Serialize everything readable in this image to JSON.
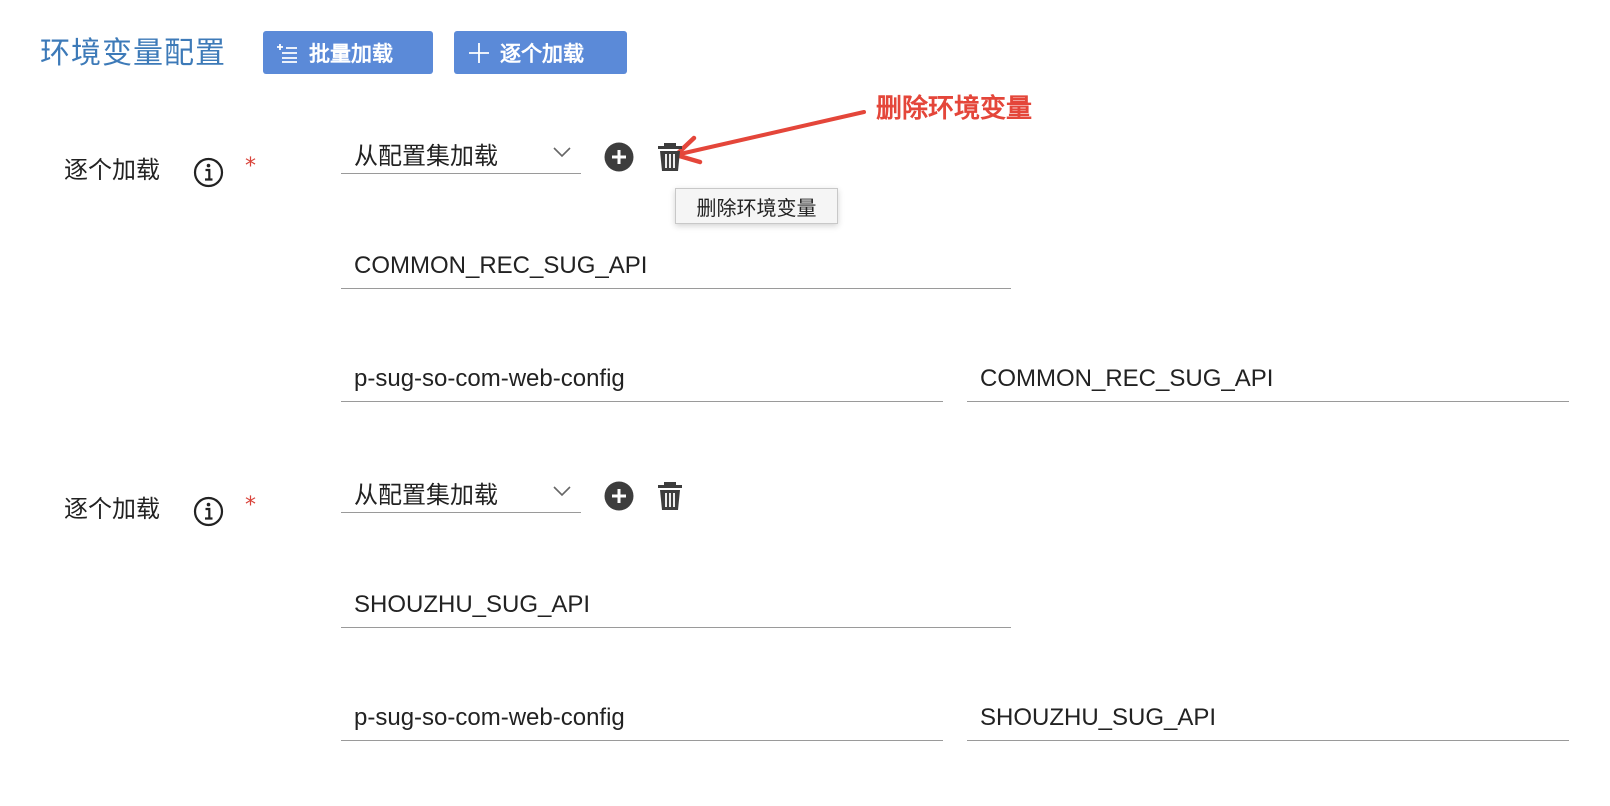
{
  "header": {
    "title": "环境变量配置",
    "batch_button": "批量加载",
    "single_button": "逐个加载"
  },
  "annotation": {
    "text": "删除环境变量",
    "color": "#e4463a"
  },
  "tooltip": {
    "text": "删除环境变量"
  },
  "colors": {
    "accent": "#5b8ad8",
    "title": "#3d7ab8",
    "required": "#d9433a"
  },
  "entries": [
    {
      "label": "逐个加载",
      "required_mark": "*",
      "source_select": "从配置集加载",
      "env_name": "COMMON_REC_SUG_API",
      "config_set": "p-sug-so-com-web-config",
      "config_key": "COMMON_REC_SUG_API"
    },
    {
      "label": "逐个加载",
      "required_mark": "*",
      "source_select": "从配置集加载",
      "env_name": "SHOUZHU_SUG_API",
      "config_set": "p-sug-so-com-web-config",
      "config_key": "SHOUZHU_SUG_API"
    }
  ]
}
